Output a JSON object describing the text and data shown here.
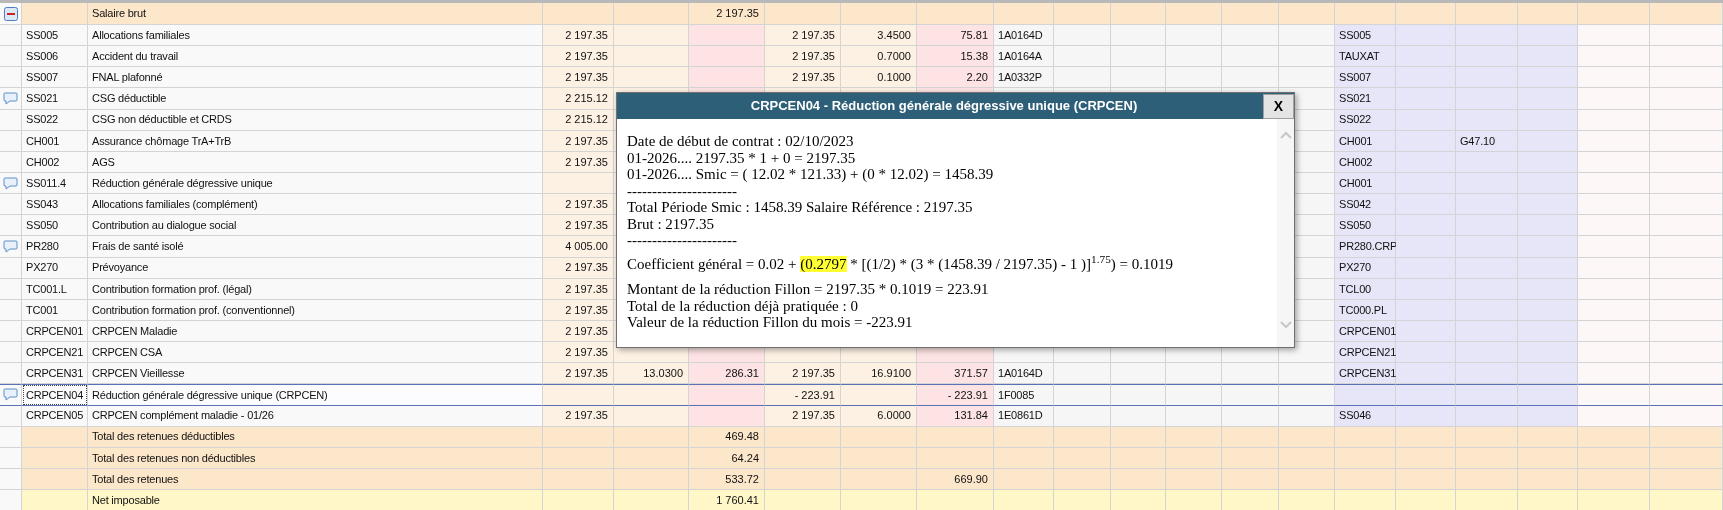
{
  "table": {
    "rows": [
      {
        "kind": "header",
        "expanded": true,
        "label": "Salaire brut",
        "cells": {
          "column_5": "2 197.35"
        }
      },
      {
        "kind": "line",
        "has_comment": false,
        "selected": false,
        "code": "SS005",
        "label": "Allocations familiales",
        "cells": {
          "column_3": "2 197.35",
          "column_6": "2 197.35",
          "column_7": "3.4500",
          "column_8": "75.81",
          "column_9": "1A0164D",
          "column_15": "SS005"
        }
      },
      {
        "kind": "line",
        "has_comment": false,
        "selected": false,
        "code": "SS006",
        "label": "Accident du travail",
        "cells": {
          "column_3": "2 197.35",
          "column_6": "2 197.35",
          "column_7": "0.7000",
          "column_8": "15.38",
          "column_9": "1A0164A",
          "column_15": "TAUXAT"
        }
      },
      {
        "kind": "line",
        "has_comment": false,
        "selected": false,
        "code": "SS007",
        "label": "FNAL plafonné",
        "cells": {
          "column_3": "2 197.35",
          "column_6": "2 197.35",
          "column_7": "0.1000",
          "column_8": "2.20",
          "column_9": "1A0332P",
          "column_15": "SS007"
        }
      },
      {
        "kind": "line",
        "has_comment": true,
        "selected": false,
        "code": "SS021",
        "label": "CSG déductible",
        "cells": {
          "column_3": "2 215.12",
          "column_15": "SS021"
        }
      },
      {
        "kind": "line",
        "has_comment": false,
        "selected": false,
        "code": "SS022",
        "label": "CSG non déductible et CRDS",
        "cells": {
          "column_3": "2 215.12",
          "column_15": "SS022"
        }
      },
      {
        "kind": "line",
        "has_comment": false,
        "selected": false,
        "code": "CH001",
        "label": "Assurance chômage TrA+TrB",
        "cells": {
          "column_3": "2 197.35",
          "column_15": "CH001",
          "column_17": "G47.10"
        }
      },
      {
        "kind": "line",
        "has_comment": false,
        "selected": false,
        "code": "CH002",
        "label": "AGS",
        "cells": {
          "column_3": "2 197.35",
          "column_15": "CH002"
        }
      },
      {
        "kind": "line",
        "has_comment": true,
        "selected": false,
        "code": "SS011.4",
        "label": "Réduction générale dégressive unique",
        "cells": {
          "column_15": "CH001"
        }
      },
      {
        "kind": "line",
        "has_comment": false,
        "selected": false,
        "code": "SS043",
        "label": "Allocations familiales (complément)",
        "cells": {
          "column_3": "2 197.35",
          "column_15": "SS042"
        }
      },
      {
        "kind": "line",
        "has_comment": false,
        "selected": false,
        "code": "SS050",
        "label": "Contribution au dialogue social",
        "cells": {
          "column_3": "2 197.35",
          "column_15": "SS050"
        }
      },
      {
        "kind": "line",
        "has_comment": true,
        "selected": false,
        "code": "PR280",
        "label": "Frais de santé isolé",
        "cells": {
          "column_3": "4 005.00",
          "column_15": "PR280.CRP"
        }
      },
      {
        "kind": "line",
        "has_comment": false,
        "selected": false,
        "code": "PX270",
        "label": "Prévoyance",
        "cells": {
          "column_3": "2 197.35",
          "column_15": "PX270"
        }
      },
      {
        "kind": "line",
        "has_comment": false,
        "selected": false,
        "code": "TC001.L",
        "label": "Contribution formation prof. (légal)",
        "cells": {
          "column_3": "2 197.35",
          "column_15": "TCL00"
        }
      },
      {
        "kind": "line",
        "has_comment": false,
        "selected": false,
        "code": "TC001",
        "label": "Contribution formation prof. (conventionnel)",
        "cells": {
          "column_3": "2 197.35",
          "column_15": "TC000.PL"
        }
      },
      {
        "kind": "line",
        "has_comment": false,
        "selected": false,
        "code": "CRPCEN01",
        "label": "CRPCEN Maladie",
        "cells": {
          "column_3": "2 197.35",
          "column_15": "CRPCEN01"
        }
      },
      {
        "kind": "line",
        "has_comment": false,
        "selected": false,
        "code": "CRPCEN21",
        "label": "CRPCEN CSA",
        "cells": {
          "column_3": "2 197.35",
          "column_15": "CRPCEN21"
        }
      },
      {
        "kind": "line",
        "has_comment": false,
        "selected": false,
        "code": "CRPCEN31",
        "label": "CRPCEN Vieillesse",
        "cells": {
          "column_3": "2 197.35",
          "column_4": "13.0300",
          "column_5": "286.31",
          "column_6": "2 197.35",
          "column_7": "16.9100",
          "column_8": "371.57",
          "column_9": "1A0164D",
          "column_15": "CRPCEN31"
        }
      },
      {
        "kind": "line",
        "has_comment": true,
        "selected": true,
        "code": "CRPCEN04",
        "label": "Réduction générale dégressive unique (CRPCEN)",
        "cells": {
          "column_6": "- 223.91",
          "column_8": "- 223.91",
          "column_9": "1F0085"
        }
      },
      {
        "kind": "line",
        "has_comment": false,
        "selected": false,
        "code": "CRPCEN05",
        "label": "CRPCEN complément maladie - 01/26",
        "cells": {
          "column_3": "2 197.35",
          "column_6": "2 197.35",
          "column_7": "6.0000",
          "column_8": "131.84",
          "column_9": "1E0861D",
          "column_15": "SS046"
        }
      },
      {
        "kind": "total",
        "label": "Total des retenues déductibles",
        "cells": {
          "column_5": "469.48"
        }
      },
      {
        "kind": "total",
        "label": "Total des retenues non déductibles",
        "cells": {
          "column_5": "64.24"
        }
      },
      {
        "kind": "total",
        "label": "Total des retenues",
        "cells": {
          "column_5": "533.72",
          "column_8": "669.90"
        }
      },
      {
        "kind": "net",
        "label": "Net imposable",
        "cells": {
          "column_5": "1 760.41"
        }
      }
    ]
  },
  "dialog": {
    "title": "CRPCEN04 - Réduction générale dégressive unique (CRPCEN)",
    "close_label": "X",
    "lines": [
      {
        "kind": "text",
        "text": "Date de début de contrat : 02/10/2023"
      },
      {
        "kind": "text",
        "text": "01-2026.... 2197.35 * 1 + 0 = 2197.35"
      },
      {
        "kind": "text",
        "text": "01-2026.... Smic = ( 12.02 * 121.33) + (0 * 12.02) = 1458.39"
      },
      {
        "kind": "text",
        "text": "----------------------"
      },
      {
        "kind": "text",
        "text": "Total Période Smic : 1458.39 Salaire Référence : 2197.35"
      },
      {
        "kind": "text",
        "text": "Brut : 2197.35"
      },
      {
        "kind": "text",
        "text": "----------------------"
      },
      {
        "kind": "highlighted",
        "before": "Coefficient général = 0.02 + ",
        "highlighted": "(0.2797",
        "after": " * [(1/2) * (3 * (1458.39 / 2197.35) - 1 )]$^{1.75}$) = 0.1019"
      },
      {
        "kind": "text",
        "text": "Montant de la réduction Fillon = 2197.35 * 0.1019 = 223.91"
      },
      {
        "kind": "text",
        "text": "Total de la réduction déjà pratiquée : 0"
      },
      {
        "kind": "text",
        "text": "Valeur de la réduction Fillon du mois = -223.91"
      }
    ]
  }
}
